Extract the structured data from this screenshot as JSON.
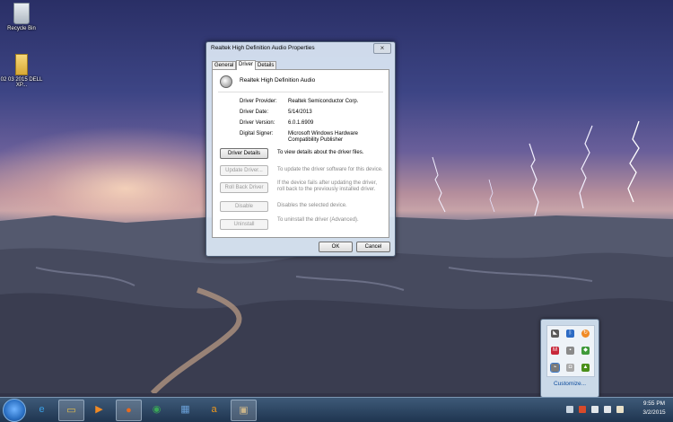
{
  "desktop": {
    "icons": [
      {
        "label": "Recycle Bin",
        "icon": "recycle-bin-icon"
      },
      {
        "label": "02 03 2015 DELL XP...",
        "icon": "folder-icon"
      }
    ]
  },
  "dialog": {
    "title": "Realtek High Definition Audio Properties",
    "close_glyph": "×",
    "tabs": [
      {
        "label": "General",
        "active": false
      },
      {
        "label": "Driver",
        "active": true
      },
      {
        "label": "Details",
        "active": false
      }
    ],
    "device_name": "Realtek High Definition Audio",
    "properties": [
      {
        "label": "Driver Provider:",
        "value": "Realtek Semiconductor Corp."
      },
      {
        "label": "Driver Date:",
        "value": "5/14/2013"
      },
      {
        "label": "Driver Version:",
        "value": "6.0.1.6909"
      },
      {
        "label": "Digital Signer:",
        "value": "Microsoft Windows Hardware Compatibility Publisher"
      }
    ],
    "actions": [
      {
        "button": "Driver Details",
        "description": "To view details about the driver files.",
        "enabled": true
      },
      {
        "button": "Update Driver...",
        "description": "To update the driver software for this device.",
        "enabled": false
      },
      {
        "button": "Roll Back Driver",
        "description": "If the device fails after updating the driver, roll back to the previously installed driver.",
        "enabled": false
      },
      {
        "button": "Disable",
        "description": "Disables the selected device.",
        "enabled": false
      },
      {
        "button": "Uninstall",
        "description": "To uninstall the driver (Advanced).",
        "enabled": false
      }
    ],
    "ok_label": "OK",
    "cancel_label": "Cancel"
  },
  "taskbar": {
    "pinned": [
      {
        "icon": "internet-explorer-icon",
        "glyph": "e",
        "color": "#3aa0e6"
      },
      {
        "icon": "file-explorer-icon",
        "glyph": "▭",
        "color": "#e8c04a"
      },
      {
        "icon": "media-player-icon",
        "glyph": "▶",
        "color": "#f08a24"
      },
      {
        "icon": "firefox-icon",
        "glyph": "●",
        "color": "#e66a1f"
      },
      {
        "icon": "chrome-icon",
        "glyph": "◉",
        "color": "#3aa757"
      },
      {
        "icon": "control-panel-icon",
        "glyph": "▦",
        "color": "#6aa0d8"
      },
      {
        "icon": "amazon-icon",
        "glyph": "a",
        "color": "#f29a1c"
      },
      {
        "icon": "device-manager-icon",
        "glyph": "▣",
        "color": "#c9b48a"
      }
    ],
    "tray_icons": [
      "show-hidden-icons-icon",
      "app-tray-icon",
      "network-icon",
      "volume-icon",
      "flag-icon"
    ],
    "clock_time": "9:55 PM",
    "clock_date": "3/2/2015"
  },
  "tray_flyout": {
    "icons": [
      "tray-app-1-icon",
      "bluetooth-icon",
      "update-icon",
      "antivirus-icon",
      "security-icon",
      "sync-icon",
      "network-adapter-icon",
      "usb-icon",
      "nvidia-icon"
    ],
    "customize_label": "Customize..."
  }
}
